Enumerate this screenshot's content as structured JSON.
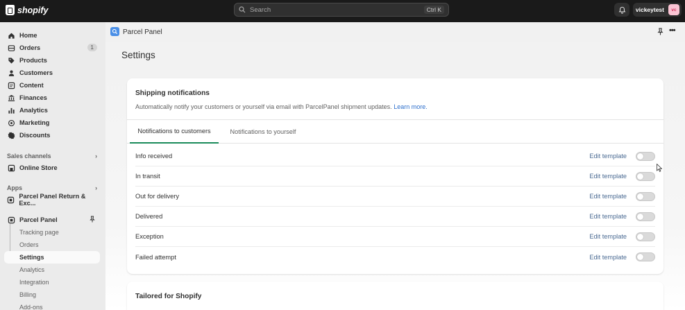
{
  "topbar": {
    "logo_text": "shopify",
    "search_placeholder": "Search",
    "search_shortcut": "Ctrl K",
    "user_name": "vickeytest",
    "avatar_initials": "vc"
  },
  "sidebar": {
    "items": [
      {
        "label": "Home",
        "icon": "home-icon"
      },
      {
        "label": "Orders",
        "icon": "orders-icon",
        "badge": "1"
      },
      {
        "label": "Products",
        "icon": "tag-icon"
      },
      {
        "label": "Customers",
        "icon": "person-icon"
      },
      {
        "label": "Content",
        "icon": "content-icon"
      },
      {
        "label": "Finances",
        "icon": "bank-icon"
      },
      {
        "label": "Analytics",
        "icon": "bar-chart-icon"
      },
      {
        "label": "Marketing",
        "icon": "target-icon"
      },
      {
        "label": "Discounts",
        "icon": "discount-icon"
      }
    ],
    "sales_channels_label": "Sales channels",
    "online_store_label": "Online Store",
    "apps_label": "Apps",
    "app_return_label": "Parcel Panel Return & Exc...",
    "app_parcel_label": "Parcel Panel",
    "sub_items": [
      "Tracking page",
      "Orders",
      "Settings",
      "Analytics",
      "Integration",
      "Billing",
      "Add-ons"
    ],
    "active_sub_item": "Settings"
  },
  "app_header": {
    "app_name": "Parcel Panel"
  },
  "page": {
    "title": "Settings"
  },
  "shipping_card": {
    "title": "Shipping notifications",
    "description": "Automatically notify your customers or yourself via email with ParcelPanel shipment updates.",
    "learn_more": "Learn more.",
    "tabs": [
      "Notifications to customers",
      "Notifications to yourself"
    ],
    "active_tab": "Notifications to customers",
    "rows": [
      {
        "label": "Info received",
        "action": "Edit template",
        "enabled": false
      },
      {
        "label": "In transit",
        "action": "Edit template",
        "enabled": false
      },
      {
        "label": "Out for delivery",
        "action": "Edit template",
        "enabled": false
      },
      {
        "label": "Delivered",
        "action": "Edit template",
        "enabled": false
      },
      {
        "label": "Exception",
        "action": "Edit template",
        "enabled": false
      },
      {
        "label": "Failed attempt",
        "action": "Edit template",
        "enabled": false
      }
    ]
  },
  "tailored_card": {
    "title": "Tailored for Shopify"
  },
  "colors": {
    "topbar": "#1a1a1a",
    "sidebar": "#ebebeb",
    "link": "#2c6ecb",
    "active_tab_underline": "#1a8a5a",
    "toggle_off": "#dadada"
  }
}
